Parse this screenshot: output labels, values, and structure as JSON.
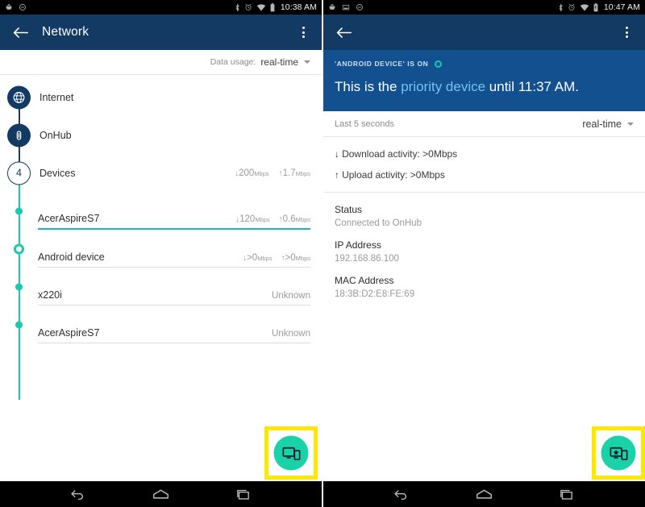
{
  "left_phone": {
    "status_bar": {
      "time": "10:38 AM",
      "left_icons": [
        "android-icon",
        "do-not-disturb-icon"
      ],
      "right_icons": [
        "bluetooth-icon",
        "alarm-icon",
        "wifi-icon",
        "battery-icon"
      ]
    },
    "app_bar": {
      "title": "Network",
      "back_icon": "back-arrow-icon",
      "overflow_icon": "overflow-menu-icon"
    },
    "usage_row": {
      "label": "Data usage:",
      "value": "real-time",
      "caret_icon": "chevron-down-icon"
    },
    "tree_nodes": [
      {
        "label": "Internet",
        "icon": "globe-icon",
        "kind": "icon",
        "down": "",
        "down_unit": "",
        "up": "",
        "up_unit": ""
      },
      {
        "label": "OnHub",
        "icon": "router-icon",
        "kind": "icon",
        "down": "",
        "down_unit": "",
        "up": "",
        "up_unit": ""
      },
      {
        "label": "Devices",
        "icon": "device-count",
        "kind": "count",
        "count": "4",
        "down": "200",
        "down_unit": "Mbps",
        "up": "1.7",
        "up_unit": "Mbps"
      }
    ],
    "devices": [
      {
        "name": "AcerAspireS7",
        "marker": "dot",
        "active": true,
        "down": "120",
        "down_unit": "Mbps",
        "up": "0.6",
        "up_unit": "Mbps",
        "unknown": ""
      },
      {
        "name": "Android device",
        "marker": "ring",
        "active": false,
        "down": ">0",
        "down_unit": "Mbps",
        "up": ">0",
        "up_unit": "Mbps",
        "unknown": ""
      },
      {
        "name": "x220i",
        "marker": "dot",
        "active": false,
        "down": "",
        "down_unit": "",
        "up": "",
        "up_unit": "",
        "unknown": "Unknown"
      },
      {
        "name": "AcerAspireS7",
        "marker": "dot",
        "active": false,
        "down": "",
        "down_unit": "",
        "up": "",
        "up_unit": "",
        "unknown": "Unknown"
      }
    ],
    "fab": {
      "icon": "devices-icon",
      "label": ""
    },
    "nav_bar": {
      "back": "nav-back-icon",
      "home": "nav-home-icon",
      "recents": "nav-recents-icon"
    }
  },
  "right_phone": {
    "status_bar": {
      "time": "10:47 AM",
      "left_icons": [
        "android-icon",
        "image-icon",
        "do-not-disturb-icon"
      ],
      "right_icons": [
        "bluetooth-icon",
        "alarm-icon",
        "wifi-icon",
        "battery-icon"
      ]
    },
    "app_bar": {
      "title": "",
      "back_icon": "back-arrow-icon",
      "overflow_icon": "overflow-menu-icon"
    },
    "banner": {
      "kicker": "'ANDROID DEVICE' IS ON",
      "status_ring_icon": "status-ring-icon",
      "text_before": "This is the ",
      "text_highlight": "priority device",
      "text_after": " until 11:37 AM."
    },
    "last_row": {
      "label": "Last 5 seconds",
      "value": "real-time",
      "caret_icon": "chevron-down-icon"
    },
    "activity": [
      {
        "arrow": "↓",
        "text": "Download activity: >0Mbps"
      },
      {
        "arrow": "↑",
        "text": "Upload activity: >0Mbps"
      }
    ],
    "details": [
      {
        "key": "Status",
        "value": "Connected to OnHub"
      },
      {
        "key": "IP Address",
        "value": "192.168.86.100"
      },
      {
        "key": "MAC Address",
        "value": "18:3B:D2:E8:FE:69"
      }
    ],
    "fab": {
      "icon": "priority-device-icon",
      "label": ""
    },
    "nav_bar": {
      "back": "nav-back-icon",
      "home": "nav-home-icon",
      "recents": "nav-recents-icon"
    }
  },
  "colors": {
    "appbar": "#123a63",
    "banner": "#12508f",
    "accent_teal": "#19c9b0",
    "accent_bar": "#19b6cf",
    "fab": "#19d2a8",
    "highlight": "#ffe800",
    "muted_text": "#9a9a9a"
  }
}
